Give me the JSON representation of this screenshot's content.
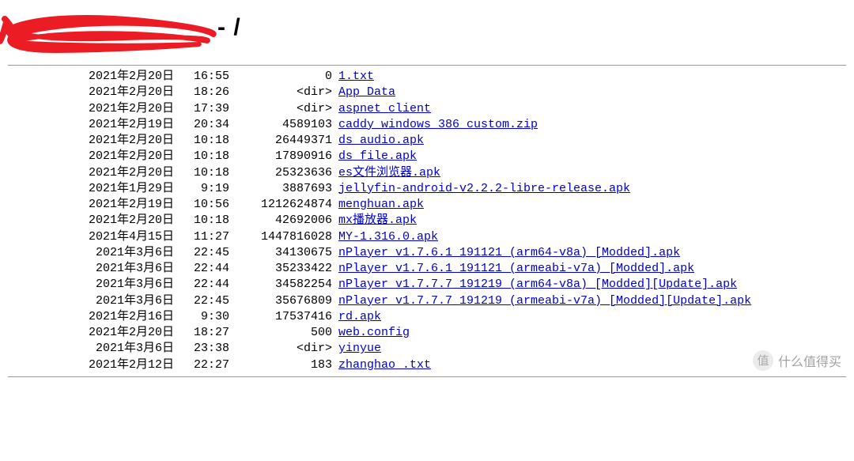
{
  "header": {
    "title_suffix": " - /"
  },
  "files": [
    {
      "date": "2021年2月20日",
      "time": "16:55",
      "size": "0",
      "name": "1.txt"
    },
    {
      "date": "2021年2月20日",
      "time": "18:26",
      "size": "<dir>",
      "name": "App_Data"
    },
    {
      "date": "2021年2月20日",
      "time": "17:39",
      "size": "<dir>",
      "name": "aspnet_client"
    },
    {
      "date": "2021年2月19日",
      "time": "20:34",
      "size": "4589103",
      "name": "caddy_windows_386_custom.zip"
    },
    {
      "date": "2021年2月20日",
      "time": "10:18",
      "size": "26449371",
      "name": "ds audio.apk"
    },
    {
      "date": "2021年2月20日",
      "time": "10:18",
      "size": "17890916",
      "name": "ds file.apk"
    },
    {
      "date": "2021年2月20日",
      "time": "10:18",
      "size": "25323636",
      "name": "es文件浏览器.apk"
    },
    {
      "date": "2021年1月29日",
      "time": "9:19",
      "size": "3887693",
      "name": "jellyfin-android-v2.2.2-libre-release.apk"
    },
    {
      "date": "2021年2月19日",
      "time": "10:56",
      "size": "1212624874",
      "name": "menghuan.apk"
    },
    {
      "date": "2021年2月20日",
      "time": "10:18",
      "size": "42692006",
      "name": "mx播放器.apk"
    },
    {
      "date": "2021年4月15日",
      "time": "11:27",
      "size": "1447816028",
      "name": "MY-1.316.0.apk"
    },
    {
      "date": "2021年3月6日",
      "time": "22:45",
      "size": "34130675",
      "name": "nPlayer v1.7.6.1_191121 (arm64-v8a) [Modded].apk"
    },
    {
      "date": "2021年3月6日",
      "time": "22:44",
      "size": "35233422",
      "name": "nPlayer v1.7.6.1_191121 (armeabi-v7a) [Modded].apk"
    },
    {
      "date": "2021年3月6日",
      "time": "22:44",
      "size": "34582254",
      "name": "nPlayer v1.7.7.7_191219 (arm64-v8a) [Modded][Update].apk"
    },
    {
      "date": "2021年3月6日",
      "time": "22:45",
      "size": "35676809",
      "name": "nPlayer v1.7.7.7_191219 (armeabi-v7a) [Modded][Update].apk"
    },
    {
      "date": "2021年2月16日",
      "time": "9:30",
      "size": "17537416",
      "name": "rd.apk"
    },
    {
      "date": "2021年2月20日",
      "time": "18:27",
      "size": "500",
      "name": "web.config"
    },
    {
      "date": "2021年3月6日",
      "time": "23:38",
      "size": "<dir>",
      "name": "yinyue"
    },
    {
      "date": "2021年2月12日",
      "time": "22:27",
      "size": "183",
      "name": "zhanghao .txt"
    }
  ],
  "watermark": {
    "icon": "值",
    "text": "什么值得买"
  }
}
